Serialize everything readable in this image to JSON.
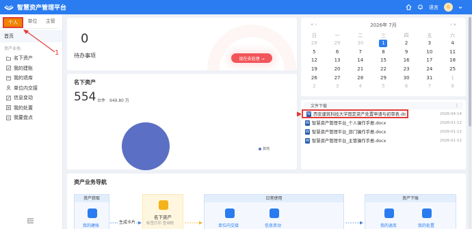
{
  "header": {
    "app_title": "智慧资产管理平台",
    "language_label": "语言",
    "avatar_text": "G",
    "accent": "#2a7cf0"
  },
  "sidebar": {
    "role_tabs": [
      {
        "label": "个人",
        "active": true
      },
      {
        "label": "单位",
        "active": false
      },
      {
        "label": "主管",
        "active": false
      }
    ],
    "home": "首页",
    "section_label": "资产业务:",
    "items": [
      {
        "label": "名下资产",
        "icon": "folder-icon"
      },
      {
        "label": "我的建账",
        "icon": "checkbox-icon"
      },
      {
        "label": "我的退库",
        "icon": "return-icon"
      },
      {
        "label": "单位内交接",
        "icon": "person-icon"
      },
      {
        "label": "信息变动",
        "icon": "edit-icon"
      },
      {
        "label": "我的处置",
        "icon": "dispose-icon"
      },
      {
        "label": "我要盘点",
        "icon": "inventory-icon"
      }
    ]
  },
  "annotations": {
    "one": "1",
    "two": "2",
    "color": "#e53935"
  },
  "todo": {
    "count": "0",
    "label": "待办事项",
    "button": "现在去处理 →"
  },
  "calendar": {
    "title": "2026年 7月",
    "prev": "«  ‹",
    "next": "›  »",
    "weekdays": [
      "日",
      "一",
      "二",
      "三",
      "四",
      "五",
      "六"
    ],
    "weeks": [
      [
        {
          "d": "28",
          "o": true
        },
        {
          "d": "29",
          "o": true
        },
        {
          "d": "30",
          "o": true
        },
        {
          "d": "1",
          "t": true
        },
        {
          "d": "2"
        },
        {
          "d": "3"
        },
        {
          "d": "4"
        }
      ],
      [
        {
          "d": "5"
        },
        {
          "d": "6"
        },
        {
          "d": "7"
        },
        {
          "d": "8"
        },
        {
          "d": "9"
        },
        {
          "d": "10"
        },
        {
          "d": "11"
        }
      ],
      [
        {
          "d": "12"
        },
        {
          "d": "13"
        },
        {
          "d": "14"
        },
        {
          "d": "15"
        },
        {
          "d": "16"
        },
        {
          "d": "17"
        },
        {
          "d": "18"
        }
      ],
      [
        {
          "d": "19"
        },
        {
          "d": "20"
        },
        {
          "d": "21"
        },
        {
          "d": "22"
        },
        {
          "d": "23"
        },
        {
          "d": "24"
        },
        {
          "d": "25"
        }
      ],
      [
        {
          "d": "26"
        },
        {
          "d": "27"
        },
        {
          "d": "28"
        },
        {
          "d": "29"
        },
        {
          "d": "30"
        },
        {
          "d": "31"
        },
        {
          "d": "1",
          "o": true
        }
      ],
      [
        {
          "d": "2",
          "o": true
        },
        {
          "d": "3",
          "o": true
        },
        {
          "d": "4",
          "o": true
        },
        {
          "d": "5",
          "o": true
        },
        {
          "d": "6",
          "o": true
        },
        {
          "d": "7",
          "o": true
        },
        {
          "d": "8",
          "o": true
        }
      ]
    ]
  },
  "assets": {
    "title": "名下资产",
    "count": "554",
    "unit": "台件",
    "value": "949.80 万",
    "legend": "其他"
  },
  "files": {
    "title": "文件下载",
    "more": "⋮",
    "items": [
      {
        "name": "西安建筑科技大学固定资产处置申请与初审表.docx",
        "date": "2026-04-14",
        "highlight": true
      },
      {
        "name": "智慧资产管理平台_个人操作手册.docx",
        "date": "2026-01-12"
      },
      {
        "name": "智慧资产管理平台_部门操作手册.docx",
        "date": "2026-01-12"
      },
      {
        "name": "智慧资产管理平台_主管操作手册.docx",
        "date": "2026-01-12"
      }
    ]
  },
  "nav": {
    "title": "资产业务导航",
    "acquire": "资产获取",
    "acquire_item": "我的建账",
    "to_card": "生成卡片",
    "owned": "名下资产",
    "owned_sub": "标签打印 查询校",
    "daily": "日常使用",
    "daily_item_1": "单位内交接",
    "daily_item_2": "信息变动",
    "offline": "资产下账",
    "offline_item_1": "我的退库",
    "offline_item_2": "我的处置"
  }
}
